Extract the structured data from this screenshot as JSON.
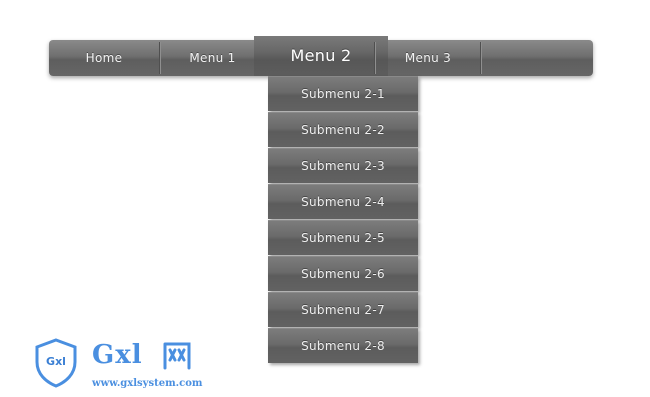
{
  "menubar": {
    "items": [
      {
        "label": "Home"
      },
      {
        "label": "Menu 1"
      },
      {
        "label": "Menu 2",
        "active": true
      },
      {
        "label": "Menu 3"
      }
    ]
  },
  "submenu": {
    "items": [
      {
        "label": "Submenu 2-1"
      },
      {
        "label": "Submenu 2-2"
      },
      {
        "label": "Submenu 2-3"
      },
      {
        "label": "Submenu 2-4"
      },
      {
        "label": "Submenu 2-5"
      },
      {
        "label": "Submenu 2-6"
      },
      {
        "label": "Submenu 2-7"
      },
      {
        "label": "Submenu 2-8"
      }
    ]
  },
  "watermark": {
    "shield_text": "Gxl",
    "brand": "Gxl",
    "brand_cn": "网",
    "url": "www.gxlsystem.com"
  },
  "colors": {
    "menu_bg": "#6f6f6f",
    "menu_text": "#f2f2f2",
    "logo_blue": "#4a8fe0"
  }
}
